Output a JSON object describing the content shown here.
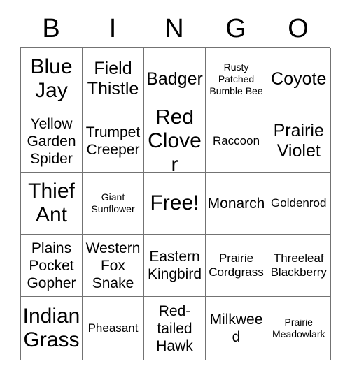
{
  "card": {
    "header_letters": [
      "B",
      "I",
      "N",
      "G",
      "O"
    ],
    "theme_colors": {
      "background": "#ffffff",
      "text": "#000000",
      "grid_line": "#737373"
    },
    "rows": [
      [
        {
          "label": "Blue Jay",
          "size": "sz-xl"
        },
        {
          "label": "Field Thistle",
          "size": "sz-lg"
        },
        {
          "label": "Badger",
          "size": "sz-lg"
        },
        {
          "label": "Rusty Patched Bumble Bee",
          "size": "sz-xs"
        },
        {
          "label": "Coyote",
          "size": "sz-lg"
        }
      ],
      [
        {
          "label": "Yellow Garden Spider",
          "size": "sz-md"
        },
        {
          "label": "Trumpet Creeper",
          "size": "sz-md"
        },
        {
          "label": "Red Clover",
          "size": "sz-xl"
        },
        {
          "label": "Raccoon",
          "size": "sz-sm"
        },
        {
          "label": "Prairie Violet",
          "size": "sz-lg"
        }
      ],
      [
        {
          "label": "Thief Ant",
          "size": "sz-xl"
        },
        {
          "label": "Giant Sunflower",
          "size": "sz-xs"
        },
        {
          "label": "Free!",
          "size": "sz-xl"
        },
        {
          "label": "Monarch",
          "size": "sz-md"
        },
        {
          "label": "Goldenrod",
          "size": "sz-sm"
        }
      ],
      [
        {
          "label": "Plains Pocket Gopher",
          "size": "sz-md"
        },
        {
          "label": "Western Fox Snake",
          "size": "sz-md"
        },
        {
          "label": "Eastern Kingbird",
          "size": "sz-md"
        },
        {
          "label": "Prairie Cordgrass",
          "size": "sz-sm"
        },
        {
          "label": "Threeleaf Blackberry",
          "size": "sz-sm"
        }
      ],
      [
        {
          "label": "Indian Grass",
          "size": "sz-xl"
        },
        {
          "label": "Pheasant",
          "size": "sz-sm"
        },
        {
          "label": "Red-tailed Hawk",
          "size": "sz-md"
        },
        {
          "label": "Milkweed",
          "size": "sz-md"
        },
        {
          "label": "Prairie Meadowlark",
          "size": "sz-xs"
        }
      ]
    ]
  }
}
